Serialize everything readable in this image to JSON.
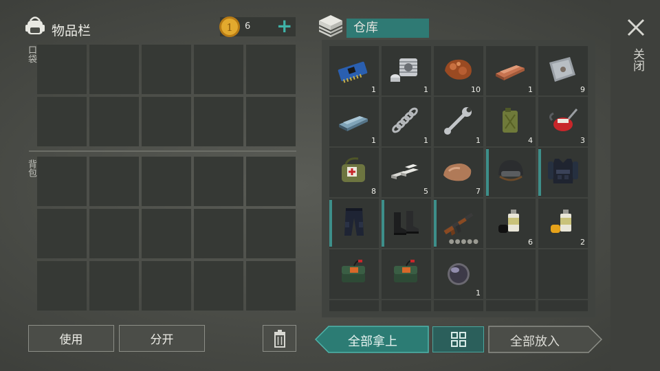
{
  "inventory": {
    "title": "物品栏",
    "coins": "6",
    "pocket_label": "口袋",
    "backpack_label": "背包",
    "use_label": "使用",
    "split_label": "分开"
  },
  "storage": {
    "title": "仓库",
    "take_all_label": "全部拿上",
    "put_all_label": "全部放入",
    "items": [
      {
        "name": "circuit-board",
        "count": "1"
      },
      {
        "name": "engine-cylinder",
        "count": "1"
      },
      {
        "name": "copper-ore",
        "count": "10"
      },
      {
        "name": "copper-ingot",
        "count": "1"
      },
      {
        "name": "metal-plate",
        "count": "9"
      },
      {
        "name": "iron-ingot",
        "count": "1"
      },
      {
        "name": "spring",
        "count": "1"
      },
      {
        "name": "wrench",
        "count": "1"
      },
      {
        "name": "jerry-can",
        "count": "4"
      },
      {
        "name": "oil-can",
        "count": "3"
      },
      {
        "name": "medical-bag",
        "count": "8"
      },
      {
        "name": "scrap-bars",
        "count": "5"
      },
      {
        "name": "stone",
        "count": "7"
      },
      {
        "name": "tactical-helmet",
        "count": ""
      },
      {
        "name": "police-vest",
        "count": ""
      },
      {
        "name": "police-pants",
        "count": ""
      },
      {
        "name": "boots",
        "count": ""
      },
      {
        "name": "assault-rifle",
        "count": ""
      },
      {
        "name": "black-spray-paint",
        "count": "6"
      },
      {
        "name": "yellow-spray-paint",
        "count": "2"
      },
      {
        "name": "explosive-charge",
        "count": ""
      },
      {
        "name": "explosive-charge",
        "count": ""
      },
      {
        "name": "lens",
        "count": "1"
      }
    ]
  },
  "side": {
    "close_label": "关闭"
  },
  "colors": {
    "accent": "#3d8f8a",
    "coin": "#d9a02a",
    "slot": "#363935"
  }
}
